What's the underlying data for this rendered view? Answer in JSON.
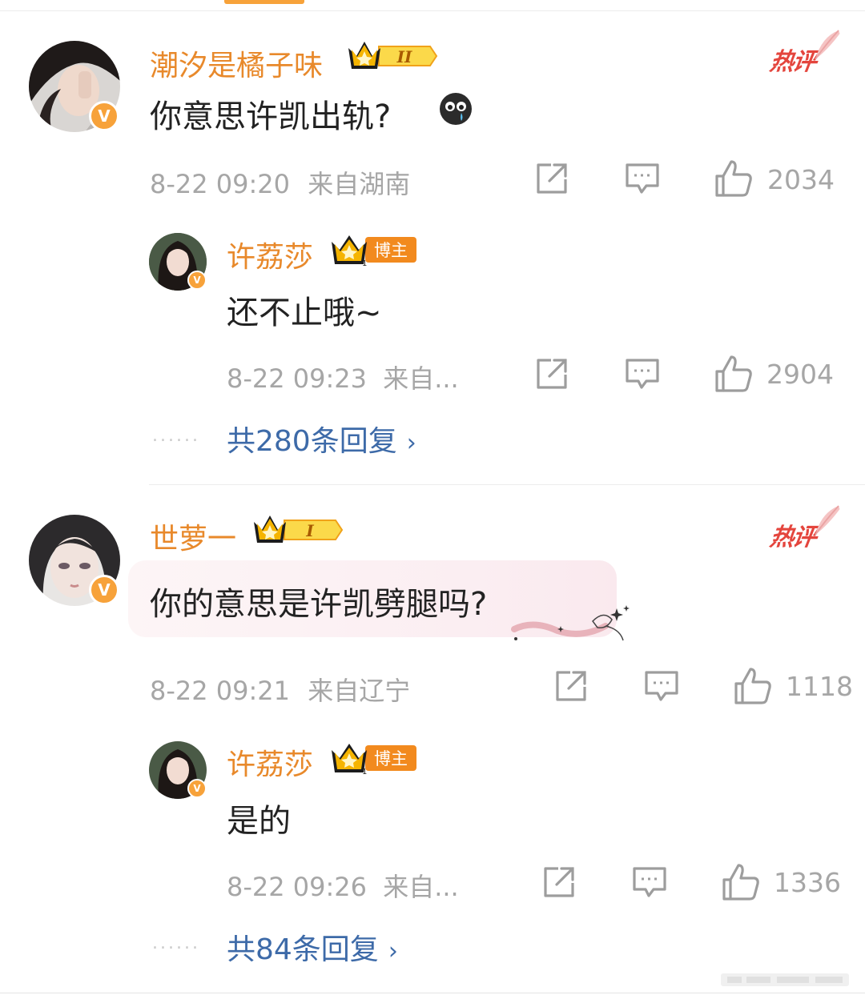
{
  "comments": [
    {
      "username": "潮汐是橘子味",
      "level_badge": "II",
      "hot_label": "热评",
      "text": "你意思许凯出轨?",
      "timestamp": "8-22 09:20",
      "location": "来自湖南",
      "like_count": "2034",
      "reply": {
        "username": "许荔莎",
        "badge_label": "博主",
        "badge_level": "1",
        "text": "还不止哦~",
        "timestamp": "8-22 09:23",
        "location": "来自...",
        "like_count": "2904"
      },
      "more_replies": "共280条回复",
      "dots": "......"
    },
    {
      "username": "世萝一",
      "level_badge": "I",
      "hot_label": "热评",
      "text": "你的意思是许凯劈腿吗?",
      "timestamp": "8-22 09:21",
      "location": "来自辽宁",
      "like_count": "1118",
      "reply": {
        "username": "许荔莎",
        "badge_label": "博主",
        "badge_level": "1",
        "text": "是的",
        "timestamp": "8-22 09:26",
        "location": "来自...",
        "like_count": "1336"
      },
      "more_replies": "共84条回复",
      "dots": "......"
    }
  ],
  "icons": {
    "verified": "V",
    "share": "share-icon",
    "comment": "comment-icon",
    "like": "like-icon",
    "emoji": "crying-emoji-icon"
  },
  "colors": {
    "username": "#e8892b",
    "hot": "#e4453d",
    "link": "#3d6aa8",
    "meta": "#a6a6a6",
    "crown": "#f5b400"
  }
}
